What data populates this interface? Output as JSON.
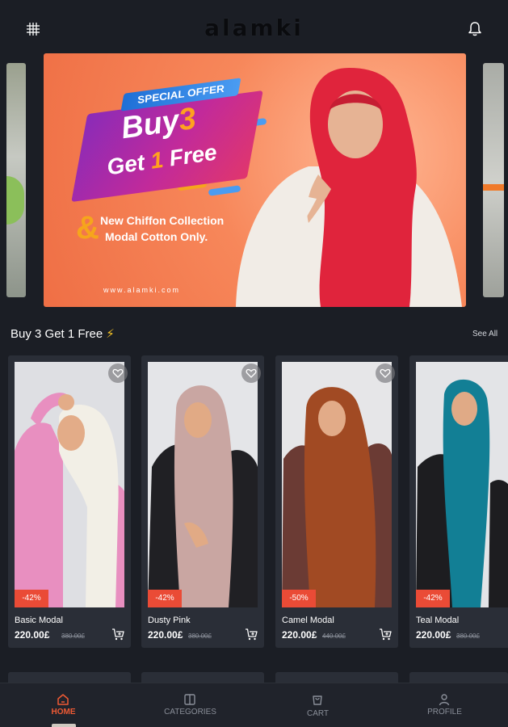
{
  "app": {
    "logo_text": "alamki"
  },
  "header": {
    "menu_icon": "grid-icon",
    "notification_icon": "bell-icon"
  },
  "banner": {
    "badge": "SPECIAL OFFER",
    "line1_word": "Buy",
    "line1_num": "3",
    "line2_word_a": "Get",
    "line2_num": "1",
    "line2_word_b": "Free",
    "ampersand": "&",
    "subtitle1": "New Chiffon Collection",
    "subtitle2": "Modal Cotton Only.",
    "website": "www.alamki.com"
  },
  "section": {
    "title": "Buy 3 Get 1 Free",
    "icon": "lightning-icon",
    "see_all": "See All"
  },
  "products": [
    {
      "name": "Basic Modal",
      "price": "220.00£",
      "old_price": "380.00£",
      "discount": "-42%"
    },
    {
      "name": "Dusty Pink",
      "price": "220.00£",
      "old_price": "380.00£",
      "discount": "-42%"
    },
    {
      "name": "Camel Modal",
      "price": "220.00£",
      "old_price": "440.00£",
      "discount": "-50%"
    },
    {
      "name": "Teal Modal",
      "price": "220.00£",
      "old_price": "380.00£",
      "discount": "-42%"
    }
  ],
  "nav": [
    {
      "label": "HOME",
      "icon": "home-icon",
      "active": true
    },
    {
      "label": "CATEGORIES",
      "icon": "categories-icon",
      "active": false
    },
    {
      "label": "CART",
      "icon": "cart-icon",
      "active": false
    },
    {
      "label": "PROFILE",
      "icon": "profile-icon",
      "active": false
    }
  ],
  "colors": {
    "background": "#1b1e25",
    "card": "#2a2e37",
    "accent": "#ef5a34",
    "discount": "#ea4b36",
    "banner_orange": "#f7875a",
    "highlight_yellow": "#f5c324"
  }
}
